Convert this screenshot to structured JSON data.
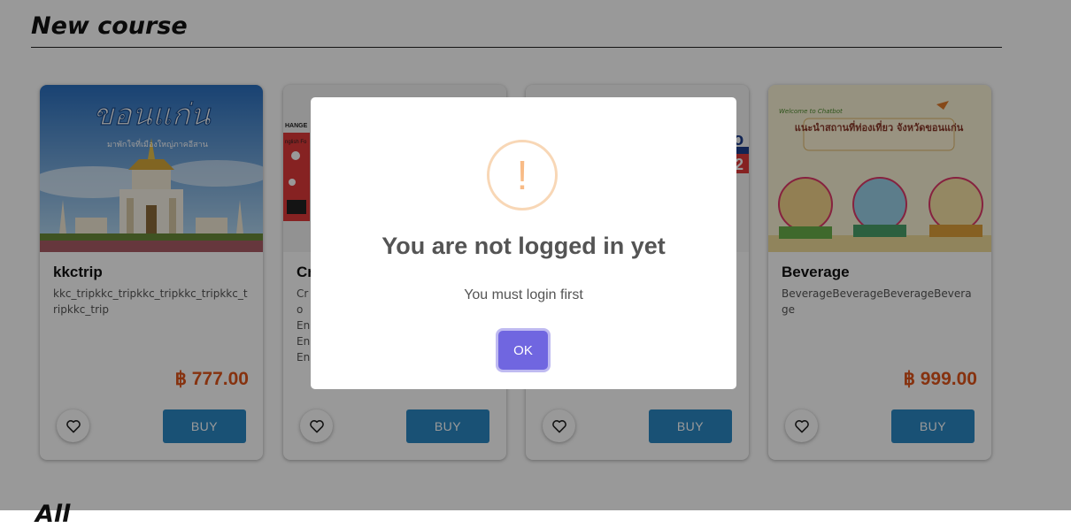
{
  "page": {
    "section_title": "New course",
    "next_section_title": "All"
  },
  "colors": {
    "price": "#e0541a",
    "buy": "#2a88c4",
    "ok": "#7066e0",
    "warning": "#f8bb86"
  },
  "courses": [
    {
      "title": "kkctrip",
      "description": "kkc_tripkkc_tripkkc_tripkkc_tripkkc_tripkkc_trip",
      "price": "฿ 777.00",
      "buy_label": "BUY",
      "image_text": "ขอนแก่น",
      "image_caption": "มาพักใจที่เมืองใหญ่ภาคอีสาน"
    },
    {
      "title": "Cr",
      "description": "Cro En En En",
      "price": "",
      "buy_label": "BUY",
      "image_text": "HANGE",
      "image_caption": "nglish Fo"
    },
    {
      "title": "",
      "description": "",
      "price": "",
      "buy_label": "BUY",
      "image_text": "o",
      "image_caption": "2"
    },
    {
      "title": "Beverage",
      "description": "BeverageBeverageBeverageBeverage",
      "price": "฿ 999.00",
      "buy_label": "BUY",
      "image_text": "แนะนำสถานที่ท่องเที่ยว จังหวัดขอนแก่น",
      "image_caption": "Welcome to Chatbot"
    }
  ],
  "modal": {
    "icon": "!",
    "title": "You are not logged in yet",
    "text": "You must login first",
    "ok_label": "OK"
  }
}
